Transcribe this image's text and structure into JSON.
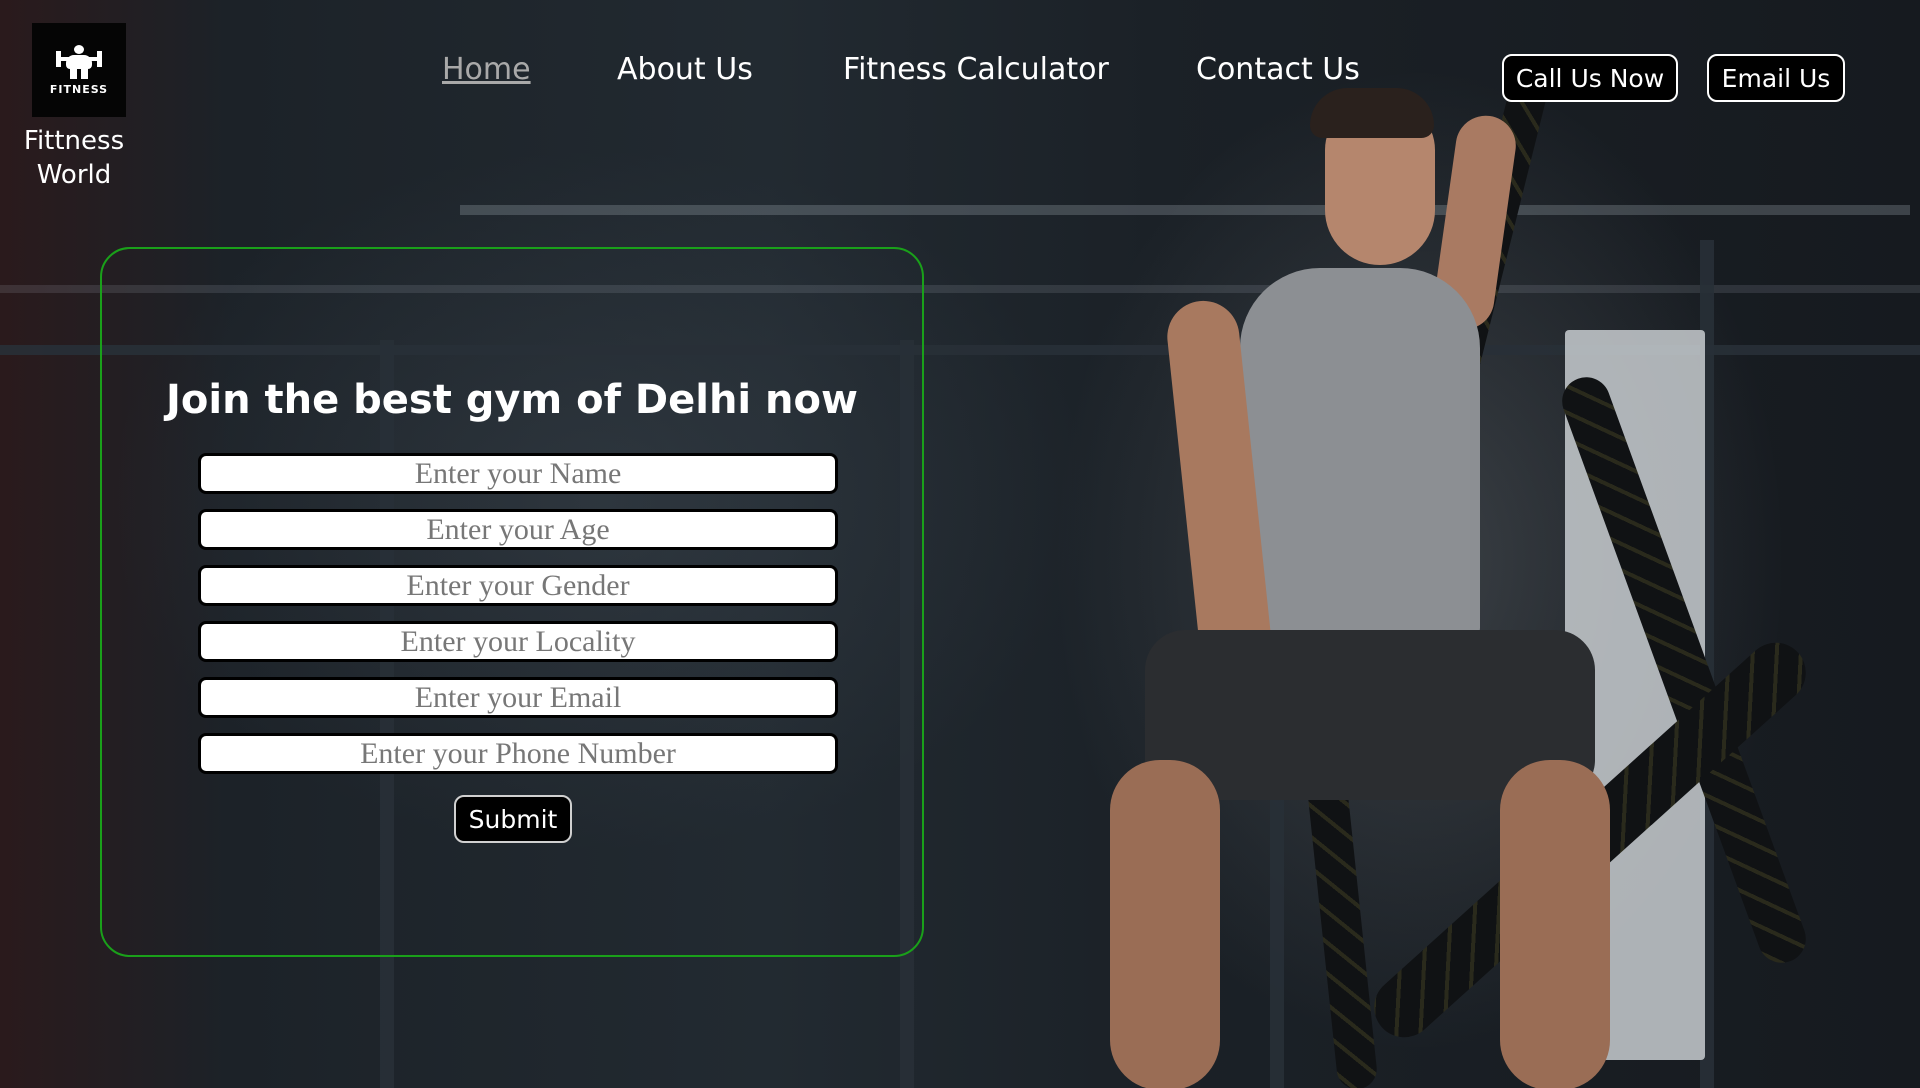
{
  "logo": {
    "text": "FITNESS",
    "brand_line1": "Fittness",
    "brand_line2": "World",
    "icon": "bodybuilder-icon"
  },
  "nav": {
    "items": [
      {
        "label": "Home",
        "active": true
      },
      {
        "label": "About Us",
        "active": false
      },
      {
        "label": "Fitness Calculator",
        "active": false
      },
      {
        "label": "Contact Us",
        "active": false
      }
    ]
  },
  "actions": {
    "call_label": "Call Us Now",
    "email_label": "Email Us"
  },
  "form": {
    "title": "Join the best gym of Delhi now",
    "fields": [
      {
        "placeholder": "Enter your Name"
      },
      {
        "placeholder": "Enter your Age"
      },
      {
        "placeholder": "Enter your Gender"
      },
      {
        "placeholder": "Enter your Locality"
      },
      {
        "placeholder": "Enter your Email"
      },
      {
        "placeholder": "Enter your Phone Number"
      }
    ],
    "submit_label": "Submit"
  },
  "colors": {
    "accent_border": "#1aa01a",
    "active_nav": "#a9a9a9",
    "button_bg": "#000000"
  }
}
